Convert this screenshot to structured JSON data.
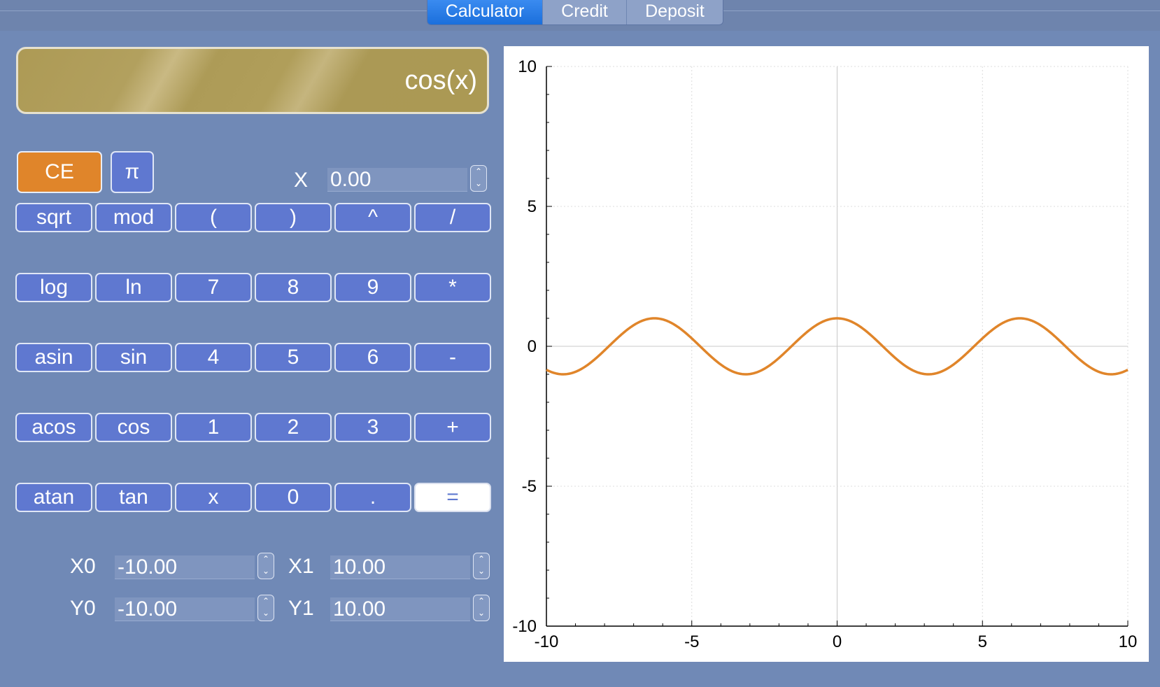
{
  "tabs": [
    {
      "label": "Calculator",
      "active": true
    },
    {
      "label": "Credit",
      "active": false
    },
    {
      "label": "Deposit",
      "active": false
    }
  ],
  "display": {
    "value": "cos(x)"
  },
  "buttons": {
    "ce": "CE",
    "pi": "π",
    "rows": [
      [
        "sqrt",
        "mod",
        "(",
        ")",
        "^",
        "/"
      ],
      [
        "log",
        "ln",
        "7",
        "8",
        "9",
        "*"
      ],
      [
        "asin",
        "sin",
        "4",
        "5",
        "6",
        "-"
      ],
      [
        "acos",
        "cos",
        "1",
        "2",
        "3",
        "+"
      ],
      [
        "atan",
        "tan",
        "x",
        "0",
        ".",
        "="
      ]
    ]
  },
  "x_input": {
    "label": "X",
    "value": "0.00"
  },
  "range": {
    "x0": {
      "label": "X0",
      "value": "-10.00"
    },
    "x1": {
      "label": "X1",
      "value": "10.00"
    },
    "y0": {
      "label": "Y0",
      "value": "-10.00"
    },
    "y1": {
      "label": "Y1",
      "value": "10.00"
    }
  },
  "colors": {
    "accent": "#e0852a",
    "button": "#5f78d0",
    "background": "#7089b6",
    "curve": "#e0852a",
    "active_tab": "#2a7de9"
  },
  "chart_data": {
    "type": "line",
    "series": [
      {
        "function": "cos(x)",
        "x": [
          -10,
          -9,
          -8,
          -7,
          -6,
          -5,
          -4,
          -3,
          -2,
          -1,
          0,
          1,
          2,
          3,
          4,
          5,
          6,
          7,
          8,
          9,
          10
        ],
        "y": [
          -0.84,
          -0.91,
          -0.15,
          0.75,
          0.96,
          0.28,
          -0.65,
          -0.99,
          -0.42,
          0.54,
          1.0,
          0.54,
          -0.42,
          -0.99,
          -0.65,
          0.28,
          0.96,
          0.75,
          -0.15,
          -0.91,
          -0.84
        ]
      }
    ],
    "xlim": [
      -10,
      10
    ],
    "ylim": [
      -10,
      10
    ],
    "xticks": [
      "-10",
      "-5",
      "0",
      "5",
      "10"
    ],
    "yticks": [
      "10",
      "5",
      "0",
      "-5",
      "-10"
    ],
    "grid": true
  }
}
